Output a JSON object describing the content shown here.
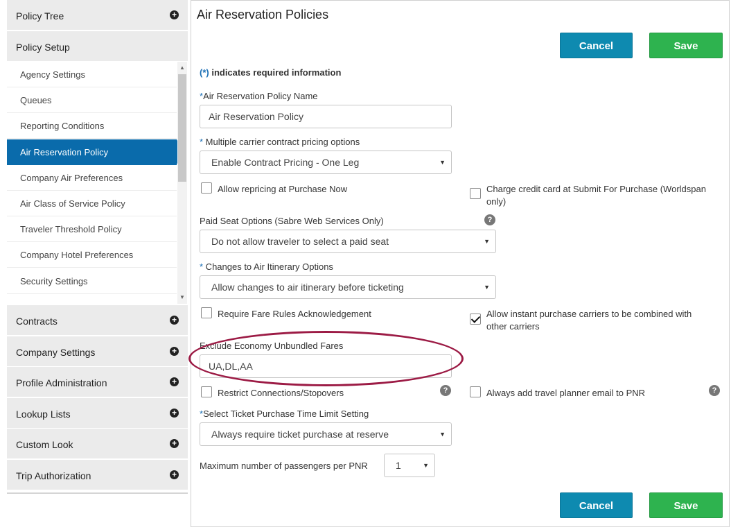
{
  "sidebar": {
    "sections_top": [
      {
        "label": "Policy Tree",
        "icon": "plus-circle-icon"
      },
      {
        "label": "Policy Setup"
      }
    ],
    "items": [
      {
        "label": "Agency Settings",
        "active": false
      },
      {
        "label": "Queues",
        "active": false
      },
      {
        "label": "Reporting Conditions",
        "active": false
      },
      {
        "label": "Air Reservation Policy",
        "active": true
      },
      {
        "label": "Company Air Preferences",
        "active": false
      },
      {
        "label": "Air Class of Service Policy",
        "active": false
      },
      {
        "label": "Traveler Threshold Policy",
        "active": false
      },
      {
        "label": "Company Hotel Preferences",
        "active": false
      },
      {
        "label": "Security Settings",
        "active": false
      }
    ],
    "sections_bottom": [
      {
        "label": "Contracts",
        "icon": "plus-circle-icon"
      },
      {
        "label": "Company Settings",
        "icon": "plus-circle-icon"
      },
      {
        "label": "Profile Administration",
        "icon": "plus-circle-icon"
      },
      {
        "label": "Lookup Lists",
        "icon": "plus-circle-icon"
      },
      {
        "label": "Custom Look",
        "icon": "plus-circle-icon"
      },
      {
        "label": "Trip Authorization",
        "icon": "plus-circle-icon"
      }
    ]
  },
  "main": {
    "title": "Air Reservation Policies",
    "buttons": {
      "cancel": "Cancel",
      "save": "Save"
    },
    "required_note": {
      "star": "(*)",
      "text": " indicates required information"
    },
    "policy_name": {
      "label": "Air Reservation Policy Name",
      "star": "*",
      "value": "Air Reservation Policy"
    },
    "pricing_options": {
      "label": " Multiple carrier contract pricing options",
      "star": "*",
      "value": "Enable Contract Pricing - One Leg"
    },
    "allow_repricing": {
      "label": "Allow repricing at Purchase Now",
      "checked": false
    },
    "charge_credit_card": {
      "label_line1": "Charge credit card at Submit For Purchase (Worldspan",
      "label_line2": "only)",
      "checked": false
    },
    "paid_seat": {
      "label": "Paid Seat Options (Sabre Web Services Only)",
      "value": "Do not allow traveler to select a paid seat"
    },
    "itinerary_changes": {
      "label": " Changes to Air Itinerary Options",
      "star": "*",
      "value": "Allow changes to air itinerary before ticketing"
    },
    "fare_rules": {
      "label": "Require Fare Rules Acknowledgement",
      "checked": false
    },
    "instant_purchase": {
      "label_line1": "Allow instant purchase carriers to be combined with",
      "label_line2": "other carriers",
      "checked": true
    },
    "exclude_economy": {
      "label": "Exclude Economy Unbundled Fares",
      "value": "UA,DL,AA"
    },
    "restrict_connections": {
      "label": "Restrict Connections/Stopovers",
      "checked": false
    },
    "travel_planner_email": {
      "label": "Always add travel planner email to PNR",
      "checked": false
    },
    "ticket_time_limit": {
      "label": "Select Ticket Purchase Time Limit Setting",
      "star": "*",
      "value": "Always require ticket purchase at reserve"
    },
    "max_passengers": {
      "label": "Maximum number of passengers per PNR",
      "value": "1"
    },
    "help_glyph": "?",
    "caret_glyph": "▼"
  },
  "colors": {
    "active_nav": "#0a6bab",
    "cancel_button": "#0e8ab0",
    "save_button": "#2eb34f",
    "highlight_oval": "#9c1b45"
  }
}
